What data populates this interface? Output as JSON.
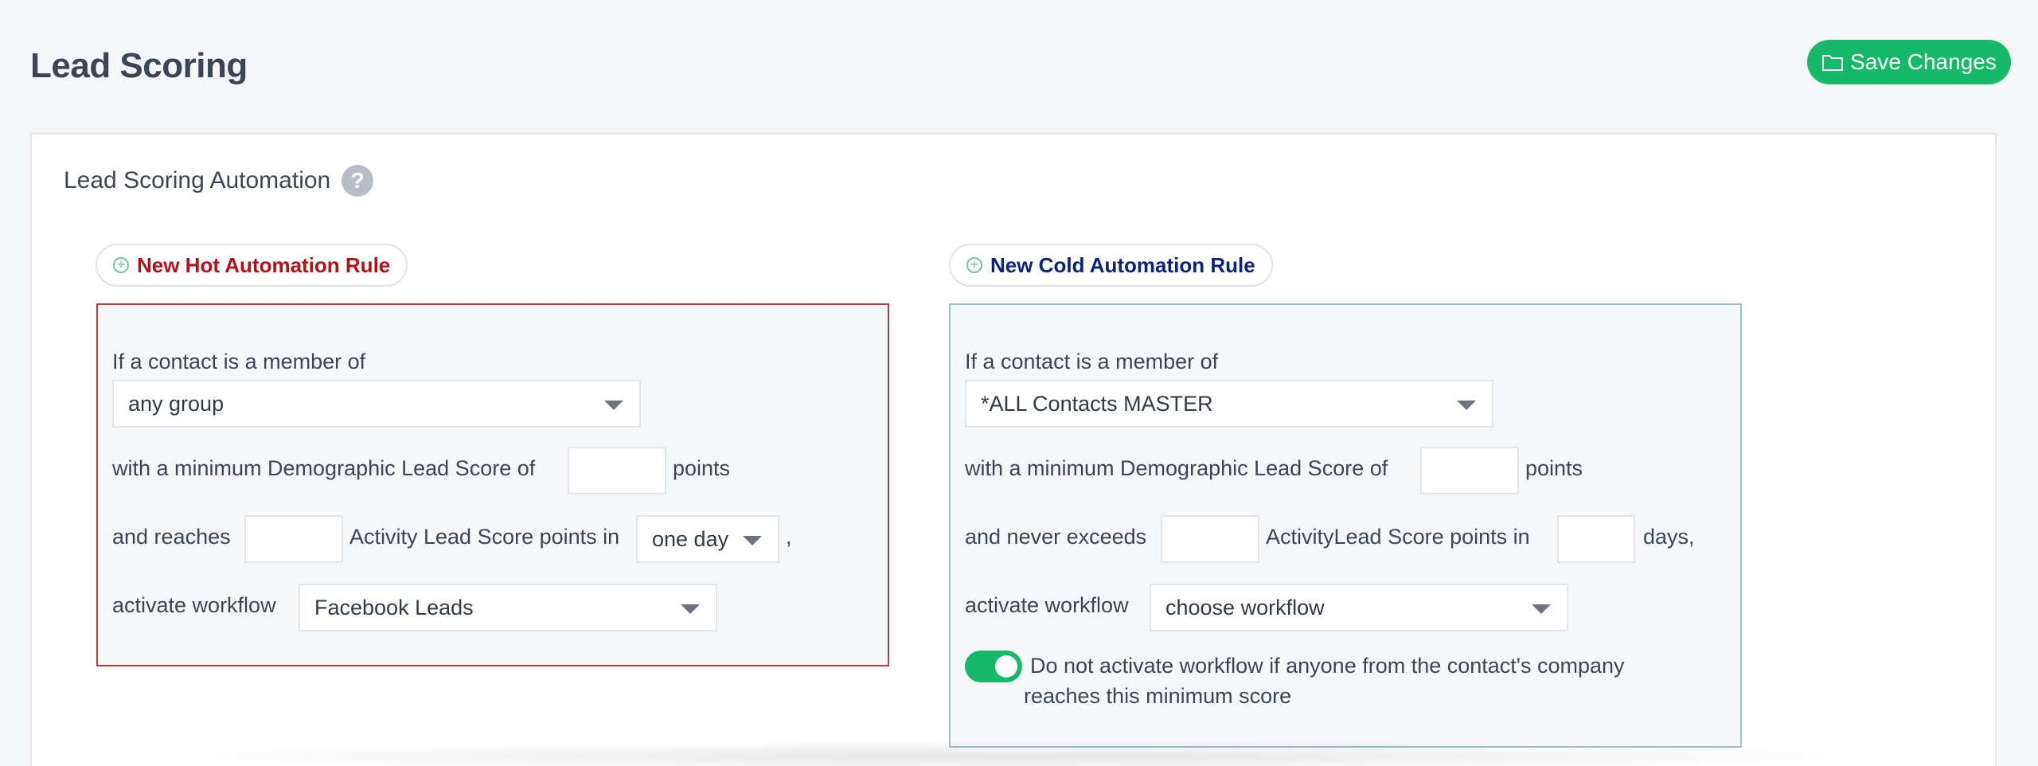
{
  "header": {
    "title": "Lead Scoring",
    "save_label": "Save Changes"
  },
  "panel": {
    "title": "Lead Scoring Automation",
    "help_glyph": "?"
  },
  "hot_rule": {
    "add_label": "New Hot Automation Rule",
    "member_label": "If a contact is a member of",
    "group_value": "any group",
    "demographic_prefix": "with a minimum Demographic Lead Score of",
    "demographic_value": "",
    "points_label": "points",
    "reaches_label": "and reaches",
    "activity_value": "",
    "activity_label": "Activity Lead Score points in",
    "period_value": "one day",
    "comma": ",",
    "workflow_label": "activate workflow",
    "workflow_value": "Facebook Leads",
    "border_color": "#c8353c",
    "label_color": "#b3121b"
  },
  "cold_rule": {
    "add_label": "New Cold Automation Rule",
    "member_label": "If a contact is a member of",
    "group_value": "*ALL Contacts MASTER",
    "demographic_prefix": "with a minimum Demographic Lead Score of",
    "demographic_value": "",
    "points_label": "points",
    "exceeds_label": "and never exceeds",
    "activity_value": "",
    "activity_label": "ActivityLead Score points in",
    "days_value": "",
    "days_label": "days,",
    "workflow_label": "activate workflow",
    "workflow_value": "choose workflow",
    "toggle_on": true,
    "toggle_line1": "Do not activate workflow if anyone from the contact's company",
    "toggle_line2": "reaches this minimum score",
    "border_color": "#9ec2cf",
    "label_color": "#0c2180"
  },
  "colors": {
    "accent_green": "#16b86a",
    "background": "#f5f6f8"
  },
  "icons": {
    "save": "folder-icon",
    "help": "help-icon",
    "add": "plus-circle-icon",
    "dropdown": "caret-down-icon"
  }
}
